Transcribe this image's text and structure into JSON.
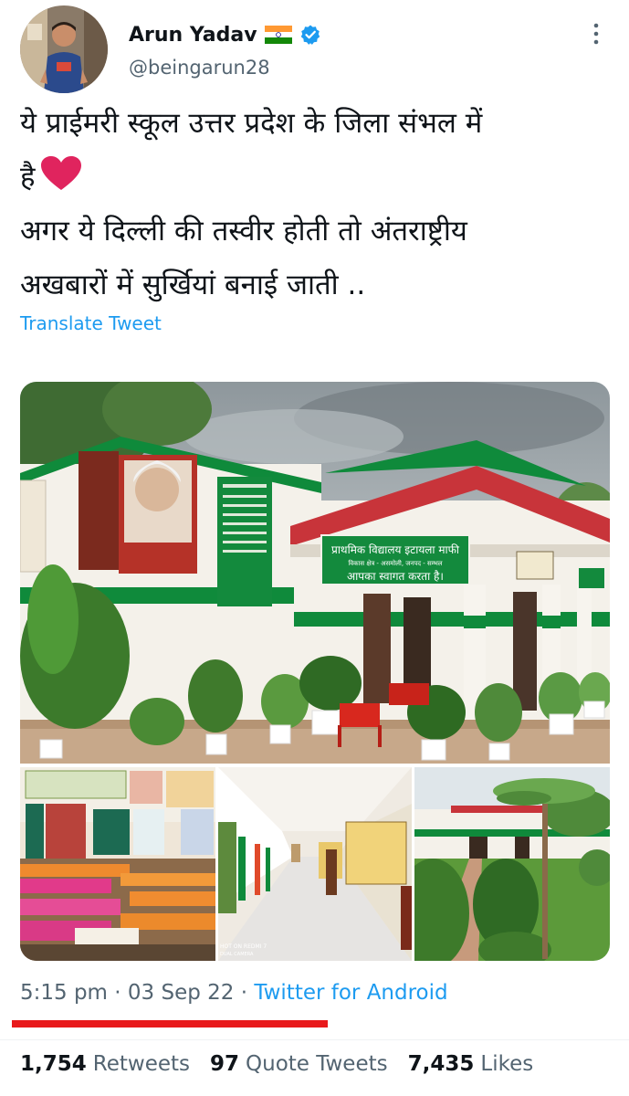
{
  "author": {
    "name": "Arun Yadav",
    "handle": "@beingarun28"
  },
  "tweet": {
    "lines": [
      "ये प्राईमरी स्कूल उत्तर प्रदेश के जिला संभल में",
      "है",
      "अगर ये दिल्ली की तस्वीर होती तो अंतराष्ट्रीय",
      "अखबारों में सुर्खियां बनाई जाती .."
    ],
    "translate_label": "Translate Tweet"
  },
  "media": {
    "main_sign": "प्राथमिक विद्यालय इटायला माफी",
    "main_sign_sub": "विकास क्षेत्र - असमोली, जनपद - सम्भल",
    "welcome_banner": "आपका स्वागत करता है।",
    "camera_watermark_1": "HOT ON REDMI 7",
    "camera_watermark_2": "DUAL CAMERA"
  },
  "meta": {
    "time": "5:15 pm",
    "separator": "·",
    "date": "03 Sep 22",
    "source": "Twitter for Android"
  },
  "stats": [
    {
      "count": "1,754",
      "label": "Retweets"
    },
    {
      "count": "97",
      "label": "Quote Tweets"
    },
    {
      "count": "7,435",
      "label": "Likes"
    }
  ],
  "colors": {
    "link_blue": "#1d9bf0",
    "secondary_text": "#536471",
    "heart_red": "#e0245e",
    "annotation_red": "#e8191b",
    "school_green": "#0f8a3b",
    "roof_red": "#c8343a"
  }
}
